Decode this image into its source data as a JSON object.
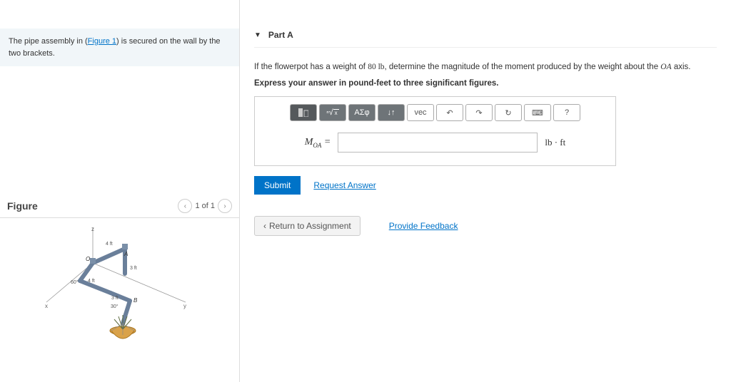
{
  "problem": {
    "prefix": "The pipe assembly in (",
    "fig_link": "Figure 1",
    "suffix": ") is secured on the wall by the two brackets."
  },
  "figure": {
    "heading": "Figure",
    "page_label": "1 of 1",
    "labels": {
      "z": "z",
      "x": "x",
      "y": "y",
      "A": "A",
      "B": "B",
      "O": "O",
      "d4ft_top": "4 ft",
      "d3ft_right": "3 ft",
      "d4ft_mid": "4 ft",
      "d3ft_low": "3 ft",
      "ang60": "60°",
      "ang30": "30°"
    }
  },
  "partA": {
    "title": "Part A",
    "question_pre": "If the flowerpot has a weight of ",
    "weight_val": "80 ",
    "weight_unit": "lb",
    "question_mid": ", determine the magnitude of the moment produced by the weight about the ",
    "axis_O": "O",
    "axis_A": "A",
    "question_post": " axis.",
    "instruction": "Express your answer in pound-feet to three significant figures.",
    "toolbar": {
      "sqrt": "√",
      "greek": "ΑΣφ",
      "arrows": "↓↑",
      "vec": "vec",
      "undo": "↶",
      "redo": "↷",
      "reset": "↻",
      "keyboard": "⌨",
      "help": "?"
    },
    "var_label": "M",
    "var_sub": "OA",
    "equals": " = ",
    "unit": "lb · ft",
    "submit": "Submit",
    "request": "Request Answer"
  },
  "footer": {
    "return": "Return to Assignment",
    "feedback": "Provide Feedback"
  }
}
